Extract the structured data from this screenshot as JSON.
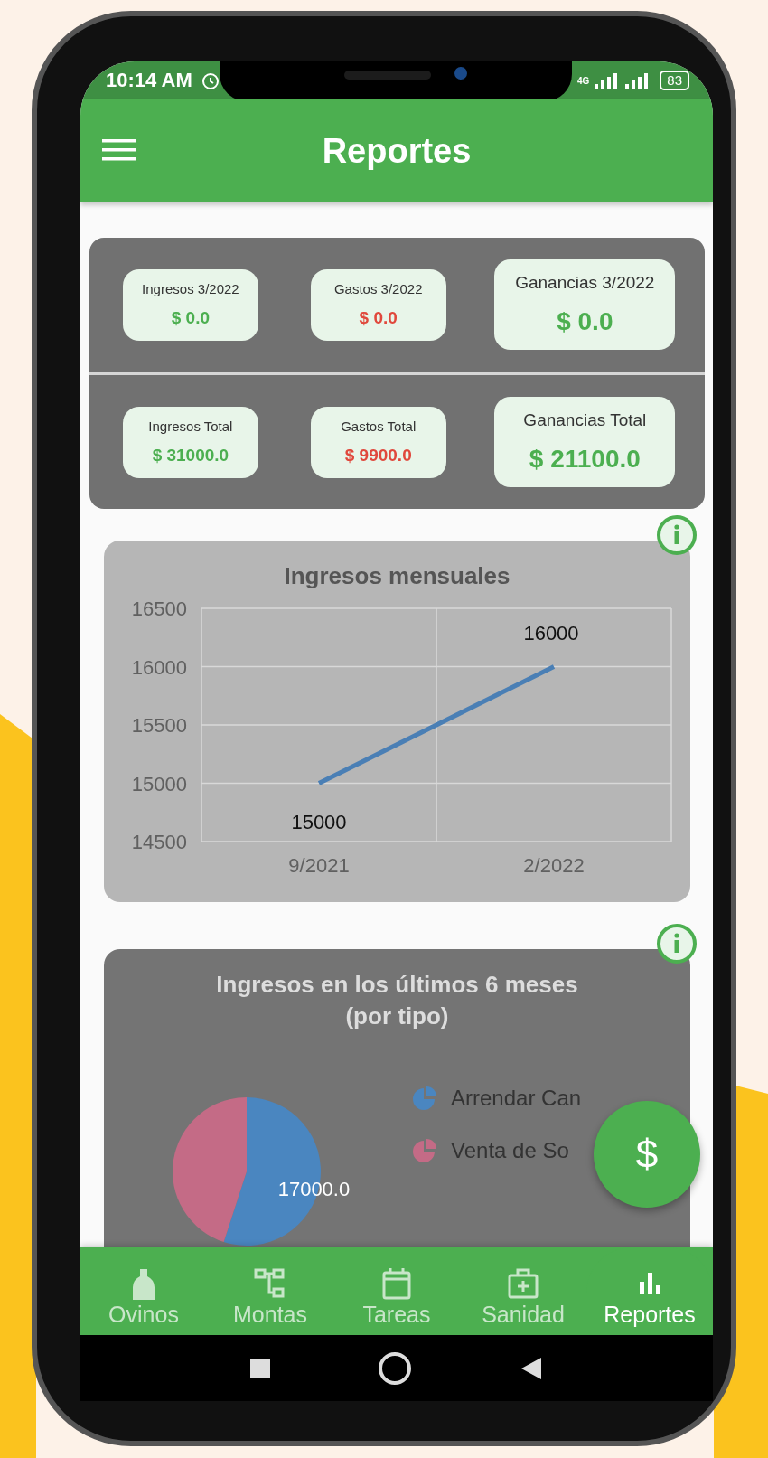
{
  "status_bar": {
    "time": "10:14 AM",
    "network": "4G",
    "battery": "83"
  },
  "app_bar": {
    "title": "Reportes"
  },
  "summary": {
    "monthly": [
      {
        "label": "Ingresos 3/2022",
        "value": "$ 0.0",
        "kind": "income"
      },
      {
        "label": "Gastos 3/2022",
        "value": "$ 0.0",
        "kind": "expense"
      },
      {
        "label": "Ganancias 3/2022",
        "value": "$ 0.0",
        "kind": "profit"
      }
    ],
    "total": [
      {
        "label": "Ingresos Total",
        "value": "$ 31000.0",
        "kind": "income"
      },
      {
        "label": "Gastos Total",
        "value": "$ 9900.0",
        "kind": "expense"
      },
      {
        "label": "Ganancias Total",
        "value": "$ 21100.0",
        "kind": "profit"
      }
    ]
  },
  "line_chart": {
    "chart_data": {
      "type": "line",
      "title": "Ingresos mensuales",
      "categories": [
        "9/2021",
        "2/2022"
      ],
      "ylim": [
        14500,
        16500
      ],
      "yticks": [
        14500,
        15000,
        15500,
        16000,
        16500
      ],
      "data_labels": true,
      "grid": true,
      "series": [
        {
          "color": "#4a7fb5",
          "values": [
            15000,
            16000
          ]
        }
      ]
    }
  },
  "pie_chart": {
    "chart_data": {
      "type": "pie",
      "title": "Ingresos en los últimos 6 meses\n(por tipo)",
      "categories": [
        "Arrendar Can",
        "Venta de So"
      ],
      "value_labels": [
        "17000.0",
        null
      ],
      "legend": true,
      "series": [
        {
          "colors": [
            "#4a86c0",
            "#c46b86"
          ],
          "values": [
            55,
            45
          ]
        }
      ]
    }
  },
  "fab": {
    "symbol": "$"
  },
  "bottom_nav": [
    {
      "label": "Ovinos",
      "selected": false
    },
    {
      "label": "Montas",
      "selected": false
    },
    {
      "label": "Tareas",
      "selected": false
    },
    {
      "label": "Sanidad",
      "selected": false
    },
    {
      "label": "Reportes",
      "selected": true
    }
  ]
}
